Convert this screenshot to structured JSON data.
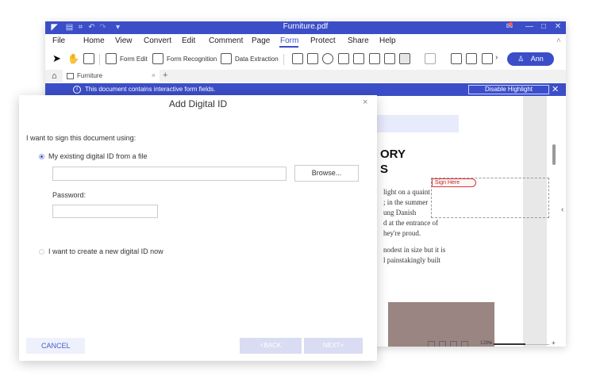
{
  "window": {
    "title": "Furniture.pdf",
    "controls": {
      "minimize": "—",
      "maximize": "□",
      "close": "✕"
    },
    "quick_icons": [
      "▤",
      "⌗",
      "↶",
      "↷",
      "▾"
    ]
  },
  "menu": {
    "items": [
      "File",
      "Home",
      "View",
      "Convert",
      "Edit",
      "Comment",
      "Page",
      "Form",
      "Protect",
      "Share",
      "Help"
    ],
    "active": "Form"
  },
  "toolbar": {
    "form_edit": "Form Edit",
    "form_recognition": "Form Recognition",
    "data_extraction": "Data Extraction",
    "more": "›",
    "user": "Ann",
    "user_icon": "♙"
  },
  "tabs": {
    "doc_tab": "Furniture",
    "close": "×",
    "new": "+",
    "home_icon": "⌂"
  },
  "infobar": {
    "message": "This document contains interactive form fields.",
    "disable_button": "Disable Highlight",
    "info_icon": "i",
    "close": "✕"
  },
  "document": {
    "heading_line1": "ORY",
    "heading_line2": "S",
    "sign_here": "Sign Here",
    "body_lines": [
      "light on a quaint",
      "; in the summer",
      "ung Danish",
      "d at the entrance of",
      "hey're proud.",
      "",
      "nodest in size but it is",
      "l painstakingly built"
    ],
    "zoom": "128%",
    "side_chevron": "‹"
  },
  "dialog": {
    "title": "Add Digital ID",
    "close": "×",
    "prompt": "I want to sign this document using:",
    "option_existing": "My existing digital ID from a file",
    "file_value": "",
    "browse_button": "Browse...",
    "password_label": "Password:",
    "password_value": "",
    "option_new": "I want to create a new digital ID now",
    "cancel_button": "CANCEL",
    "back_button": "<BACK",
    "next_button": "NEXT>"
  },
  "colors": {
    "accent": "#3b4ec8",
    "infobar": "#3b4ec8",
    "disabled_button": "#d9dcf2",
    "cancel_bg": "#eef0fb"
  }
}
